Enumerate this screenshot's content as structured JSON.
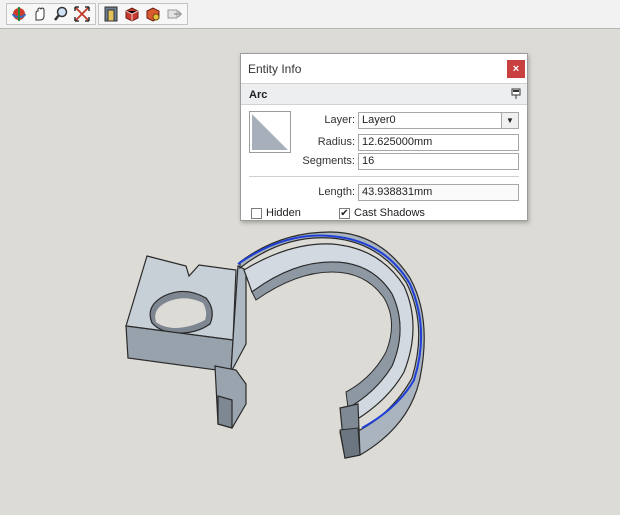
{
  "toolbar": {
    "groups": [
      {
        "name": "camera",
        "icons": [
          "orbit-icon",
          "pan-icon",
          "zoom-icon",
          "zoom-extents-icon"
        ]
      },
      {
        "name": "warehouse",
        "icons": [
          "3d-warehouse-icon",
          "share-model-icon",
          "share-component-icon",
          "extension-warehouse-icon"
        ]
      }
    ]
  },
  "entity_info": {
    "title": "Entity Info",
    "close_label": "×",
    "entity_type": "Arc",
    "layer_label": "Layer:",
    "layer_value": "Layer0",
    "radius_label": "Radius:",
    "radius_value": "12.625000mm",
    "segments_label": "Segments:",
    "segments_value": "16",
    "length_label": "Length:",
    "length_value": "43.938831mm",
    "hidden_label": "Hidden",
    "hidden_checked": false,
    "cast_shadows_label": "Cast Shadows",
    "cast_shadows_checked": true
  },
  "colors": {
    "viewport_bg": "#dcdbd6",
    "selection": "#1f3fd6",
    "close_button": "#c94040"
  }
}
